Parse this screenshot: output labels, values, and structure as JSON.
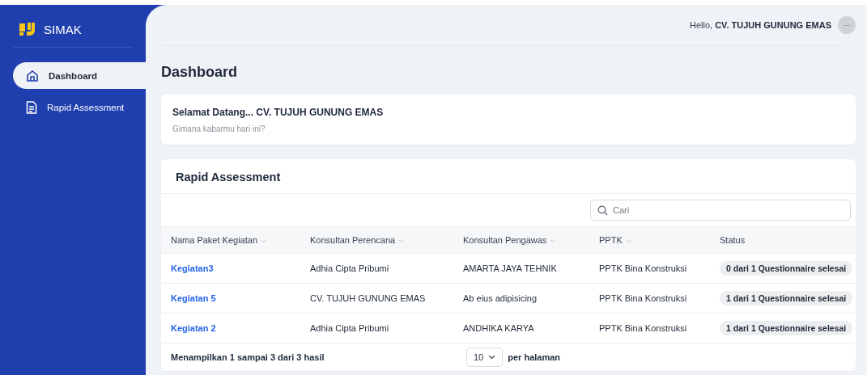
{
  "app": {
    "name": "SIMAK"
  },
  "sidebar": {
    "items": [
      {
        "label": "Dashboard",
        "selected": true
      },
      {
        "label": "Rapid Assessment",
        "selected": false
      }
    ]
  },
  "header": {
    "greeting": "Hello,",
    "user": "CV. TUJUH GUNUNG EMAS"
  },
  "page_title": "Dashboard",
  "welcome": {
    "title": "Selamat Datang... CV. TUJUH GUNUNG EMAS",
    "subtitle": "Gimana kabarmu hari ini?"
  },
  "assessment": {
    "title": "Rapid Assessment",
    "search": {
      "placeholder": "Cari"
    },
    "columns": [
      {
        "label": "Nama Paket Kegiatan",
        "sortable": true
      },
      {
        "label": "Konsultan Perencana",
        "sortable": true
      },
      {
        "label": "Konsultan Pengawas",
        "sortable": true
      },
      {
        "label": "PPTK",
        "sortable": true
      },
      {
        "label": "Status",
        "sortable": false
      }
    ],
    "rows": [
      {
        "name": "Kegiatan3",
        "perencana": "Adhia Cipta Pribumi",
        "pengawas": "AMARTA JAYA TEHNIK",
        "pptk": "PPTK Bina Konstruksi",
        "status": "0 dari 1 Questionnaire selesai"
      },
      {
        "name": "Kegiatan 5",
        "perencana": "CV. TUJUH GUNUNG EMAS",
        "pengawas": "Ab eius adipisicing",
        "pptk": "PPTK Bina Konstruksi",
        "status": "1 dari 1 Questionnaire selesai"
      },
      {
        "name": "Kegiatan 2",
        "perencana": "Adhia Cipta Pribumi",
        "pengawas": "ANDHIKA KARYA",
        "pptk": "PPTK Bina Konstruksi",
        "status": "1 dari 1 Questionnaire selesai"
      }
    ],
    "footer": {
      "summary": "Menampilkan 1 sampai 3 dari 3 hasil",
      "per_page": "10",
      "per_page_label": "per halaman"
    }
  }
}
